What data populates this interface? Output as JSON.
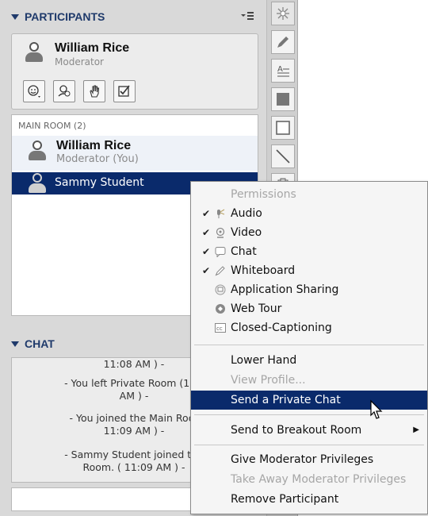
{
  "participants": {
    "title": "PARTICIPANTS",
    "moderator_card": {
      "name": "William Rice",
      "role": "Moderator"
    },
    "status_buttons": [
      "smiley-icon",
      "away-icon",
      "raise-hand-icon",
      "checkbox-icon"
    ],
    "room_label": "MAIN ROOM (2)",
    "users": [
      {
        "name": "William Rice",
        "status": "Moderator (You)"
      },
      {
        "name": "Sammy Student"
      }
    ]
  },
  "chat": {
    "title": "CHAT",
    "lines": [
      "11:08 AM ) -",
      "- You left Private Room (1). (",
      "AM ) -",
      "- You joined the Main Roor",
      "11:09 AM ) -",
      "- Sammy Student joined the",
      "Room. ( 11:09 AM ) -"
    ]
  },
  "context_menu": {
    "permissions_label": "Permissions",
    "permissions": [
      {
        "label": "Audio",
        "checked": true,
        "icon": "microphone-icon"
      },
      {
        "label": "Video",
        "checked": true,
        "icon": "webcam-icon"
      },
      {
        "label": "Chat",
        "checked": true,
        "icon": "chat-bubble-icon"
      },
      {
        "label": "Whiteboard",
        "checked": true,
        "icon": "pencil-icon"
      },
      {
        "label": "Application Sharing",
        "checked": false,
        "icon": "app-share-icon"
      },
      {
        "label": "Web Tour",
        "checked": false,
        "icon": "globe-icon"
      },
      {
        "label": "Closed-Captioning",
        "checked": false,
        "icon": "cc-icon"
      }
    ],
    "lower_hand": "Lower Hand",
    "view_profile": "View Profile...",
    "send_private_chat": "Send a Private Chat",
    "send_breakout": "Send to Breakout Room",
    "give_moderator": "Give Moderator Privileges",
    "take_moderator": "Take Away Moderator Privileges",
    "remove_participant": "Remove Participant"
  },
  "toolbar": {
    "tools": [
      "laser-pointer-icon",
      "pencil-icon",
      "text-tool-icon",
      "filled-rectangle-icon",
      "rectangle-icon",
      "line-icon",
      "clipboard-icon"
    ]
  },
  "colors": {
    "selection": "#0a2a6b",
    "header_text": "#1f3a6b"
  }
}
